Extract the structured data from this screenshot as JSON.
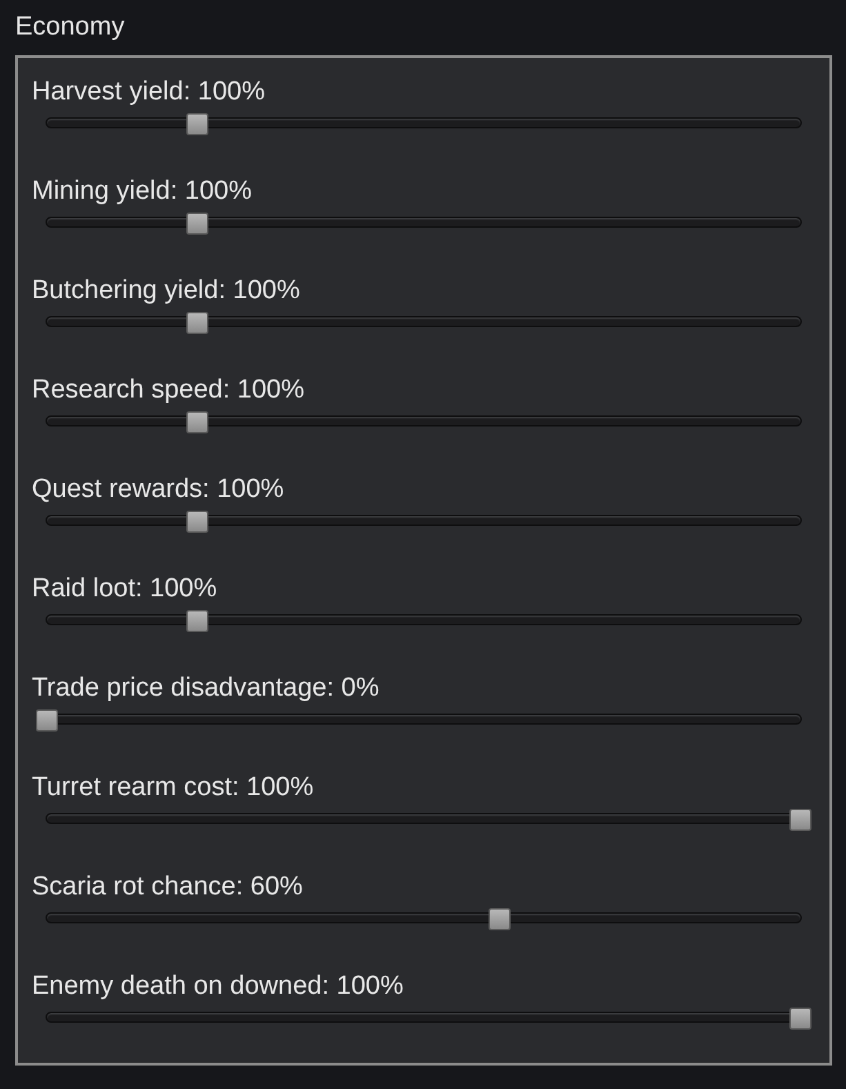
{
  "section": {
    "title": "Economy"
  },
  "sliders": [
    {
      "label": "Harvest yield: 100%",
      "level": 0.2
    },
    {
      "label": "Mining yield: 100%",
      "level": 0.2
    },
    {
      "label": "Butchering yield: 100%",
      "level": 0.2
    },
    {
      "label": "Research speed: 100%",
      "level": 0.2
    },
    {
      "label": "Quest rewards: 100%",
      "level": 0.2
    },
    {
      "label": "Raid loot: 100%",
      "level": 0.2
    },
    {
      "label": "Trade price disadvantage: 0%",
      "level": 0
    },
    {
      "label": "Turret rearm cost: 100%",
      "level": 1
    },
    {
      "label": "Scaria rot chance: 60%",
      "level": 0.6
    },
    {
      "label": "Enemy death on downed: 100%",
      "level": 1
    }
  ]
}
